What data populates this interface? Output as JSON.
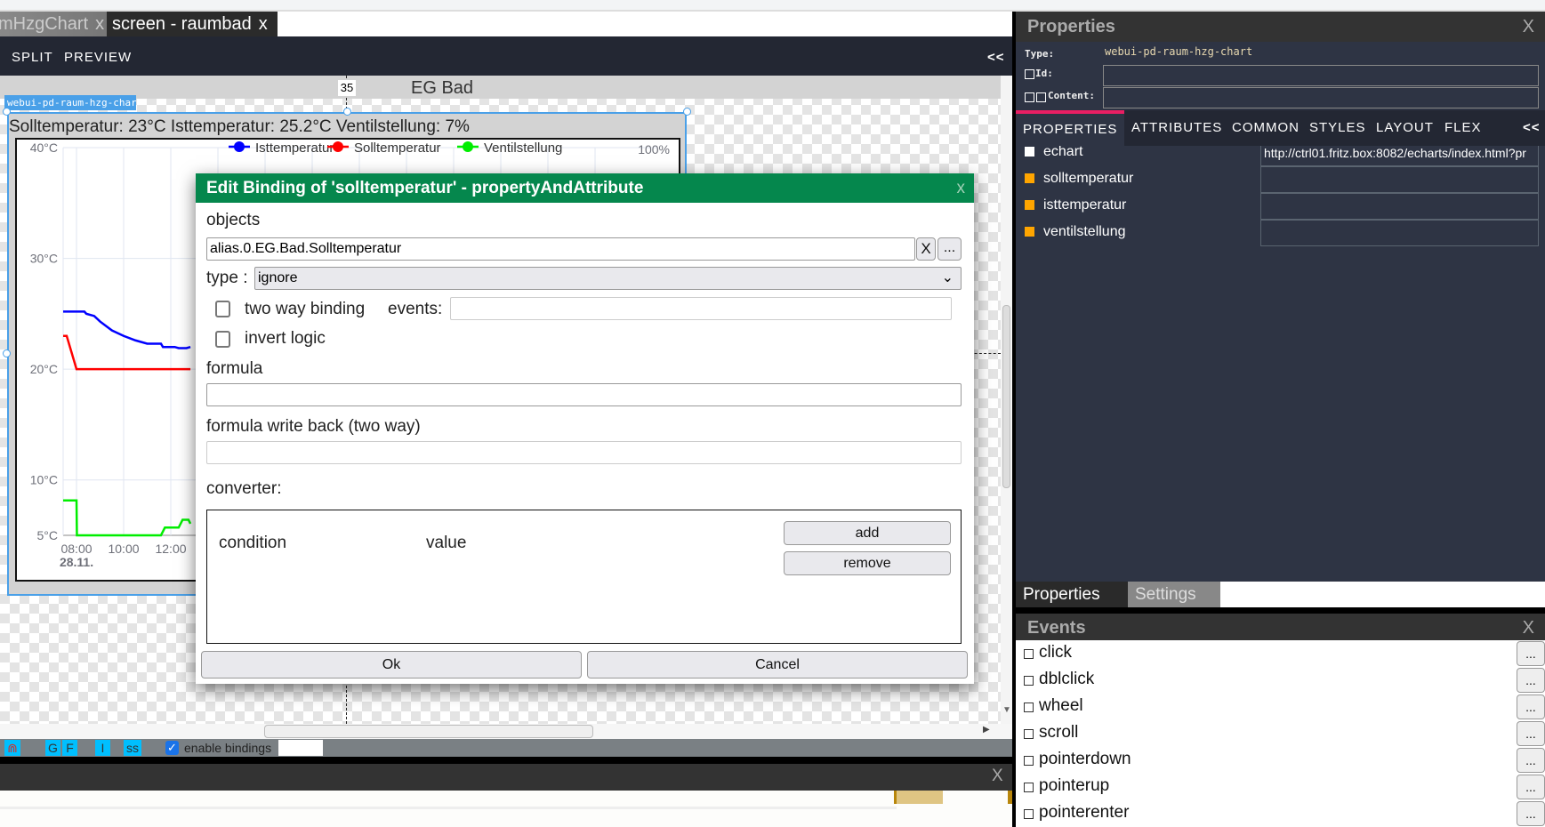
{
  "tabs": [
    {
      "label": "mHzgChart",
      "close": "x"
    },
    {
      "label": "screen - raumbad",
      "close": "x"
    }
  ],
  "toolbar": {
    "split": "SPLIT",
    "preview": "PREVIEW",
    "collapse": "<<"
  },
  "canvas": {
    "ruler_value": "35",
    "screen_title": "EG Bad"
  },
  "widget": {
    "type_label": "webui-pd-raum-hzg-chart",
    "title": "Solltemperatur: 23°C Isttemperatur: 25.2°C Ventilstellung: 7%"
  },
  "statusbar": {
    "buttons": [
      "G",
      "F",
      "I",
      "ss"
    ],
    "enable_bindings": "enable bindings",
    "enable_bindings_checked": true
  },
  "bottom_panel": {
    "close": "X"
  },
  "properties": {
    "title": "Properties",
    "close": "X",
    "type_label": "Type:",
    "type_value": "webui-pd-raum-hzg-chart",
    "id_label": "Id:",
    "content_label": "Content:",
    "tabs": [
      "PROPERTIES",
      "ATTRIBUTES",
      "COMMON",
      "STYLES",
      "LAYOUT",
      "FLEX"
    ],
    "active_tab": "PROPERTIES",
    "collapse": "<<",
    "items": [
      {
        "name": "echart",
        "value": "http://ctrl01.fritz.box:8082/echarts/index.html?pr",
        "color": "#ffffff"
      },
      {
        "name": "solltemperatur",
        "value": "",
        "color": "#ffa500"
      },
      {
        "name": "isttemperatur",
        "value": "",
        "color": "#ffa500"
      },
      {
        "name": "ventilstellung",
        "value": "",
        "color": "#ffa500"
      }
    ],
    "bottom_tabs": [
      "Properties",
      "Settings"
    ]
  },
  "events": {
    "title": "Events",
    "close": "X",
    "button": "...",
    "items": [
      "click",
      "dblclick",
      "wheel",
      "scroll",
      "pointerdown",
      "pointerup",
      "pointerenter"
    ]
  },
  "dialog": {
    "title": "Edit Binding of 'solltemperatur' - propertyAndAttribute",
    "close": "x",
    "objects_label": "objects",
    "objects_value": "alias.0.EG.Bad.Solltemperatur",
    "clear": "X",
    "browse": "...",
    "type_label": "type :",
    "type_value": "ignore",
    "two_way_label": "two way binding",
    "events_label": "events:",
    "events_value": "",
    "invert_label": "invert logic",
    "formula_label": "formula",
    "formula_value": "",
    "formula_back_label": "formula write back (two way)",
    "formula_back_value": "",
    "converter_label": "converter:",
    "condition_header": "condition",
    "value_header": "value",
    "add": "add",
    "remove": "remove",
    "ok": "Ok",
    "cancel": "Cancel"
  },
  "chart_data": {
    "type": "line",
    "y_ticks": [
      "40°C",
      "30°C",
      "20°C",
      "10°C",
      "5°C"
    ],
    "y_tick_values": [
      40,
      30,
      20,
      10,
      5
    ],
    "ylim": [
      5,
      40
    ],
    "y2_tick": "100%",
    "y2lim": [
      0,
      100
    ],
    "x_ticks": [
      "08:00",
      "10:00",
      "12:00"
    ],
    "x_date_label": "28.11.",
    "grid": true,
    "legend_position": "top",
    "colors": {
      "Isttemperatur": "#0000ff",
      "Solltemperatur": "#ff0000",
      "Ventilstellung": "#00ee00"
    },
    "series": [
      {
        "name": "Isttemperatur",
        "axis": "left",
        "x": [
          "07:26",
          "08:20",
          "08:25",
          "08:45",
          "09:00",
          "09:30",
          "10:00",
          "10:30",
          "11:00",
          "11:35",
          "11:40",
          "12:10",
          "12:20",
          "12:40",
          "12:50"
        ],
        "values": [
          25.2,
          25.2,
          25.0,
          24.8,
          24.3,
          23.5,
          23.0,
          22.6,
          22.3,
          22.3,
          22.0,
          22.0,
          21.9,
          21.9,
          22.0
        ]
      },
      {
        "name": "Solltemperatur",
        "axis": "left",
        "x": [
          "07:26",
          "07:35",
          "08:00",
          "12:50"
        ],
        "values": [
          23,
          23,
          20,
          20
        ]
      },
      {
        "name": "Ventilstellung",
        "axis": "right",
        "x": [
          "07:26",
          "08:00",
          "08:01",
          "11:35",
          "11:45",
          "12:20",
          "12:30",
          "12:45",
          "12:50"
        ],
        "values": [
          9,
          9,
          0,
          0,
          2,
          2,
          4,
          4,
          3
        ]
      }
    ]
  }
}
